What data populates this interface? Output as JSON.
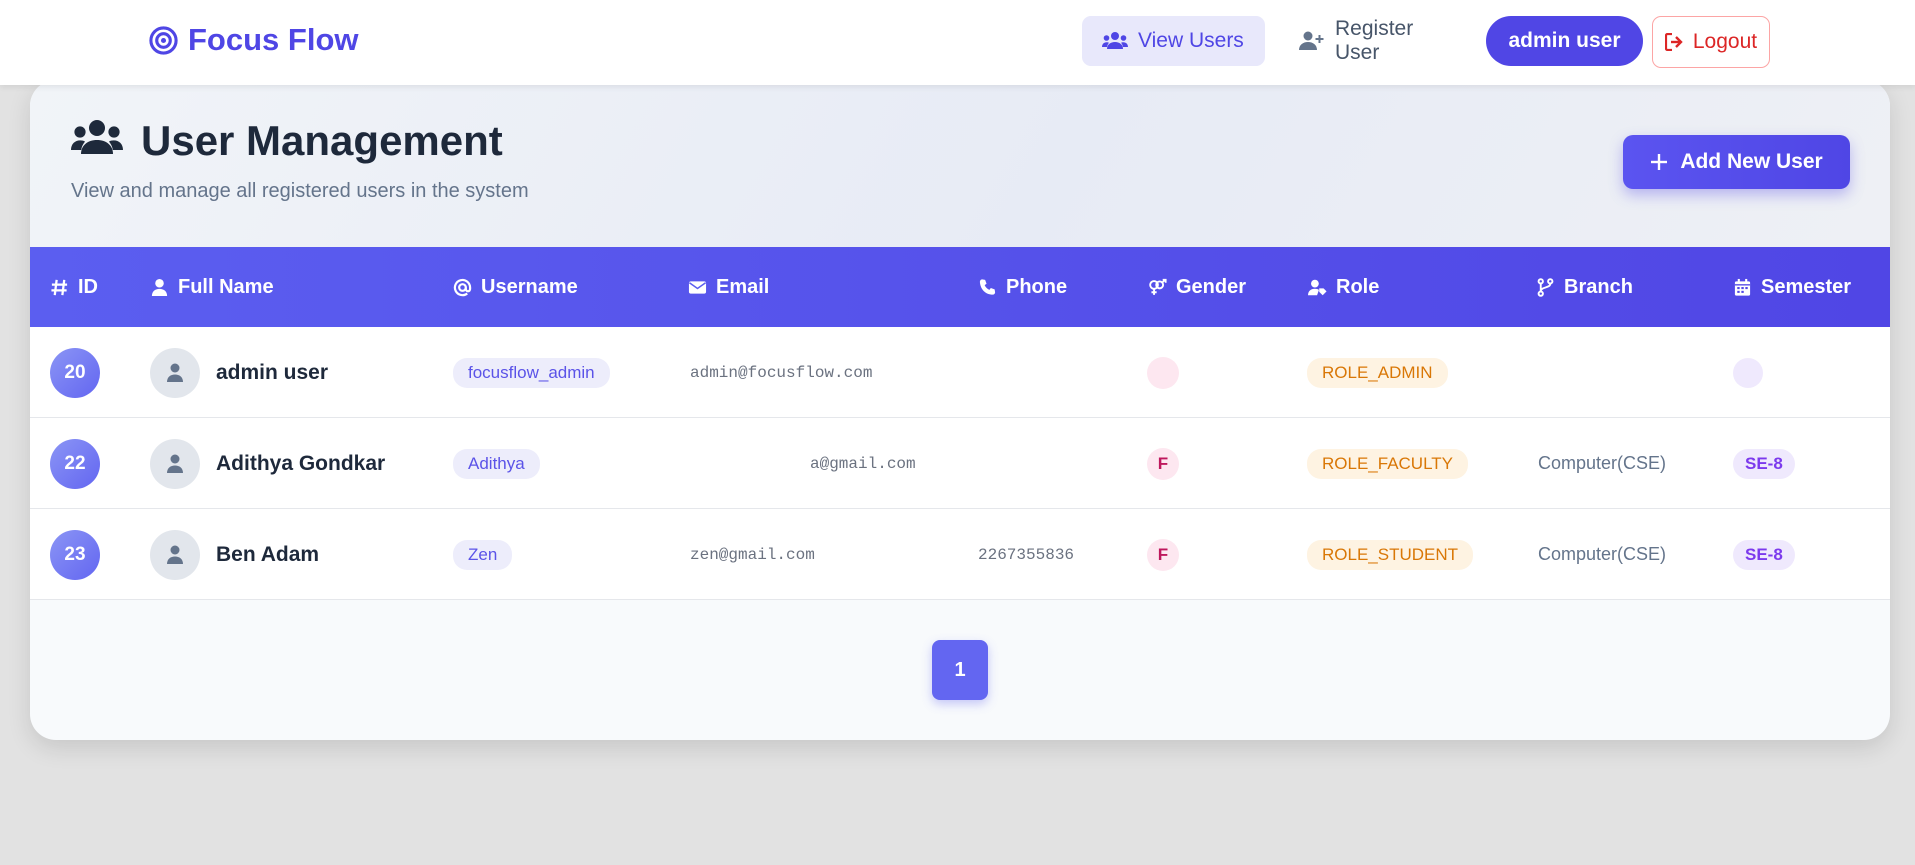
{
  "navbar": {
    "brand": "Focus Flow",
    "view_users": "View Users",
    "register_user": "Register User",
    "current_user": "admin user",
    "logout": "Logout"
  },
  "header": {
    "title": "User Management",
    "subtitle": "View and manage all registered users in the system",
    "add_button": "Add New User"
  },
  "table": {
    "columns": [
      "ID",
      "Full Name",
      "Username",
      "Email",
      "Phone",
      "Gender",
      "Role",
      "Branch",
      "Semester"
    ],
    "rows": [
      {
        "id": "20",
        "full_name": "admin user",
        "username": "focusflow_admin",
        "email": "admin@focusflow.com",
        "phone": "",
        "gender": "",
        "role": "ROLE_ADMIN",
        "branch": "",
        "semester": ""
      },
      {
        "id": "22",
        "full_name": "Adithya Gondkar",
        "username": "Adithya",
        "email": "a@gmail.com",
        "phone": "",
        "gender": "F",
        "role": "ROLE_FACULTY",
        "branch": "Computer(CSE)",
        "semester": "SE-8"
      },
      {
        "id": "23",
        "full_name": "Ben Adam",
        "username": "Zen",
        "email": "zen@gmail.com",
        "phone": "2267355836",
        "gender": "F",
        "role": "ROLE_STUDENT",
        "branch": "Computer(CSE)",
        "semester": "SE-8"
      }
    ]
  },
  "pagination": {
    "current_page": "1"
  },
  "colors": {
    "accent": "#4f46e5",
    "danger": "#dc2626",
    "role": "#d97706",
    "semester": "#7c3aed"
  }
}
